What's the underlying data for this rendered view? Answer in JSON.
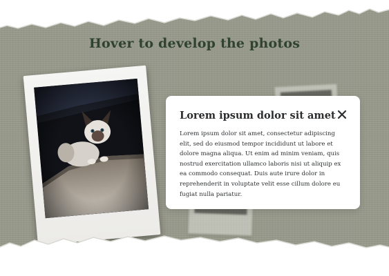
{
  "page": {
    "title": "Hover to develop the photos"
  },
  "photo": {
    "subject": "siamese-cat-photo"
  },
  "modal": {
    "title": "Lorem ipsum dolor sit amet",
    "body": "Lorem ipsum dolor sit amet, consectetur adipiscing elit, sed do eiusmod tempor incididunt ut labore et dolore magna aliqua. Ut enim ad minim veniam, quis nostrud exercitation ullamco laboris nisi ut aliquip ex ea commodo consequat. Duis aute irure dolor in reprehenderit in voluptate velit esse cillum dolore eu fugiat nulla pariatur.",
    "close_icon": "close-icon"
  },
  "colors": {
    "background": "#9a9c8d",
    "title": "#2f4330",
    "card": "#ffffff"
  }
}
